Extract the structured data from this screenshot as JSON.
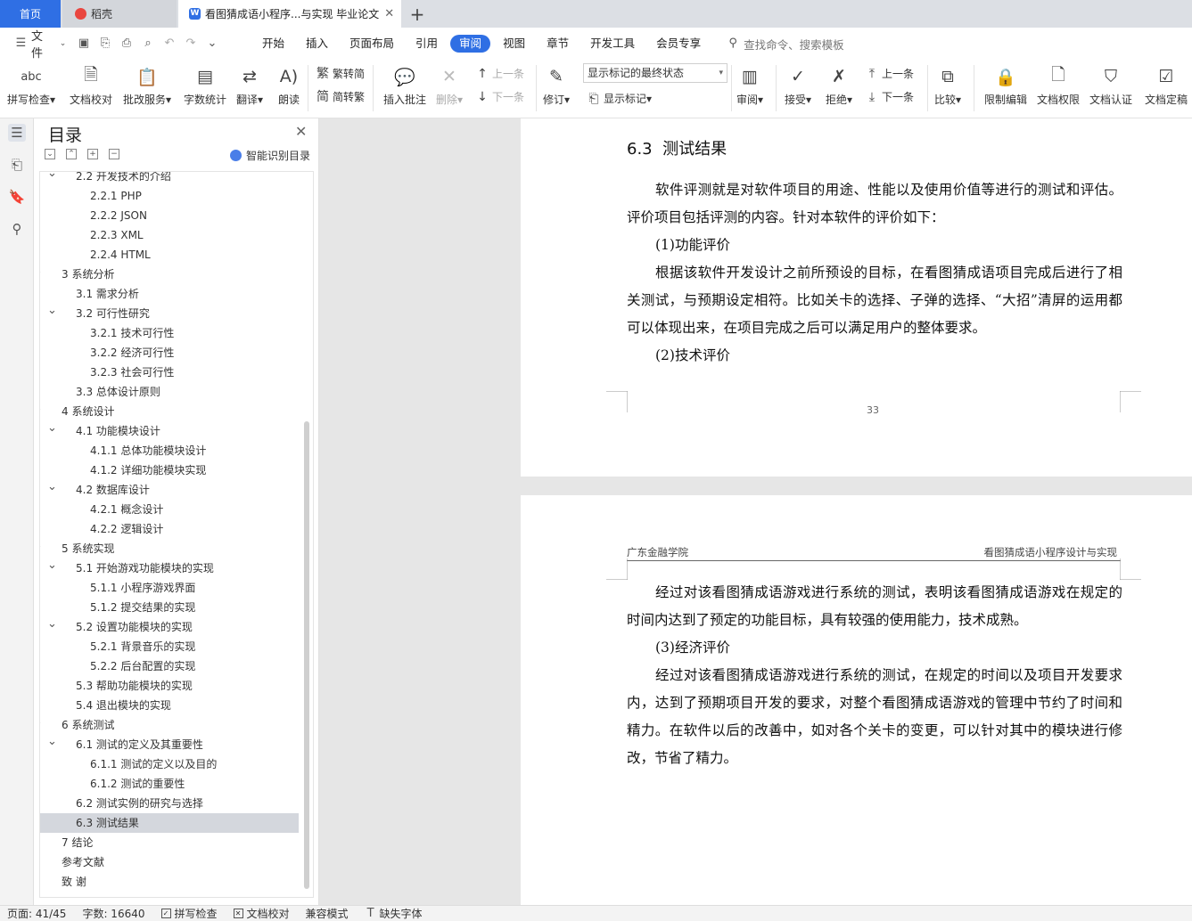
{
  "tabs": {
    "home": "首页",
    "daoke": "稻壳",
    "doc": "看图猜成语小程序...与实现 毕业论文",
    "add": "+"
  },
  "menu": {
    "file": "文件",
    "items": [
      "开始",
      "插入",
      "页面布局",
      "引用",
      "审阅",
      "视图",
      "章节",
      "开发工具",
      "会员专享"
    ],
    "active": "审阅",
    "search": "查找命令、搜索模板"
  },
  "ribbon": {
    "spellcheck": "拼写检查",
    "doc_proof": "文档校对",
    "annot_service": "批改服务",
    "word_count": "字数统计",
    "translate": "翻译",
    "read_aloud": "朗读",
    "to_traditional": "繁转简",
    "to_simplified": "简转繁",
    "insert_comment": "插入批注",
    "delete": "删除",
    "prev": "上一条",
    "next": "下一条",
    "revise": "修订",
    "display_state": "显示标记的最终状态",
    "show_marks": "显示标记",
    "review": "审阅",
    "accept": "接受",
    "reject": "拒绝",
    "prev2": "上一条",
    "next2": "下一条",
    "compare": "比较",
    "restrict_edit": "限制编辑",
    "doc_permission": "文档权限",
    "doc_certify": "文档认证",
    "doc_finalize": "文档定稿"
  },
  "toc": {
    "title": "目录",
    "smart": "智能识别目录",
    "items": [
      {
        "text": "2.2 开发技术的介绍",
        "level": 2,
        "chev": true
      },
      {
        "text": "2.2.1 PHP",
        "level": 3
      },
      {
        "text": "2.2.2 JSON",
        "level": 3
      },
      {
        "text": "2.2.3 XML",
        "level": 3
      },
      {
        "text": "2.2.4 HTML",
        "level": 3
      },
      {
        "text": "3  系统分析",
        "level": 1,
        "chev": true
      },
      {
        "text": "3.1  需求分析",
        "level": 2
      },
      {
        "text": "3.2  可行性研究",
        "level": 2,
        "chev": true
      },
      {
        "text": "3.2.1  技术可行性",
        "level": 3
      },
      {
        "text": "3.2.2  经济可行性",
        "level": 3
      },
      {
        "text": "3.2.3  社会可行性",
        "level": 3
      },
      {
        "text": "3.3  总体设计原则",
        "level": 2
      },
      {
        "text": "4  系统设计",
        "level": 1,
        "chev": true
      },
      {
        "text": "4.1  功能模块设计",
        "level": 2,
        "chev": true
      },
      {
        "text": "4.1.1  总体功能模块设计",
        "level": 3
      },
      {
        "text": "4.1.2  详细功能模块实现",
        "level": 3
      },
      {
        "text": "4.2  数据库设计",
        "level": 2,
        "chev": true
      },
      {
        "text": "4.2.1  概念设计",
        "level": 3
      },
      {
        "text": "4.2.2  逻辑设计",
        "level": 3
      },
      {
        "text": "5  系统实现",
        "level": 1,
        "chev": true
      },
      {
        "text": "5.1  开始游戏功能模块的实现",
        "level": 2,
        "chev": true
      },
      {
        "text": "5.1.1 小程序游戏界面",
        "level": 3
      },
      {
        "text": "5.1.2  提交结果的实现",
        "level": 3
      },
      {
        "text": "5.2  设置功能模块的实现",
        "level": 2,
        "chev": true
      },
      {
        "text": "5.2.1  背景音乐的实现",
        "level": 3
      },
      {
        "text": "5.2.2  后台配置的实现",
        "level": 3
      },
      {
        "text": "5.3 帮助功能模块的实现",
        "level": 2
      },
      {
        "text": "5.4 退出模块的实现",
        "level": 2
      },
      {
        "text": "6  系统测试",
        "level": 1,
        "chev": true
      },
      {
        "text": "6.1  测试的定义及其重要性",
        "level": 2,
        "chev": true
      },
      {
        "text": "6.1.1  测试的定义以及目的",
        "level": 3
      },
      {
        "text": "6.1.2  测试的重要性",
        "level": 3
      },
      {
        "text": "6.2  测试实例的研究与选择",
        "level": 2
      },
      {
        "text": "6.3  测试结果",
        "level": 2,
        "selected": true
      },
      {
        "text": "7  结论",
        "level": 1
      },
      {
        "text": "参考文献",
        "level": 1
      },
      {
        "text": "致    谢",
        "level": 1
      }
    ]
  },
  "document": {
    "section_num": "6.3",
    "section_title": "测试结果",
    "p1_l1": "软件评测就是对软件项目的用途、性能以及使用价值等进行的测试和评估。",
    "p1_l2": "评价项目包括评测的内容。针对本软件的评价如下：",
    "item1": "(1)功能评价",
    "p2_l1": "根据该软件开发设计之前所预设的目标，在看图猜成语项目完成后进行了相",
    "p2_l2": "关测试，与预期设定相符。比如关卡的选择、子弹的选择、“大招”清屏的运用都",
    "p2_l3": "可以体现出来，在项目完成之后可以满足用户的整体要求。",
    "item2": "(2)技术评价",
    "page_number": "33",
    "header_left": "广东金融学院",
    "header_right": "看图猜成语小程序设计与实现",
    "p3_l1": "经过对该看图猜成语游戏进行系统的测试，表明该看图猜成语游戏在规定的",
    "p3_l2": "时间内达到了预定的功能目标，具有较强的使用能力，技术成熟。",
    "item3": "(3)经济评价",
    "p4_l1": "经过对该看图猜成语游戏进行系统的测试，在规定的时间以及项目开发要求",
    "p4_l2": "内，达到了预期项目开发的要求，对整个看图猜成语游戏的管理中节约了时间和",
    "p4_l3": "精力。在软件以后的改善中，如对各个关卡的变更，可以针对其中的模块进行修",
    "p4_l4": "改，节省了精力。"
  },
  "status": {
    "page": "页面: 41/45",
    "words": "字数: 16640",
    "spell": "拼写检查",
    "proof": "文档校对",
    "compat": "兼容模式",
    "missing_font": "缺失字体"
  }
}
